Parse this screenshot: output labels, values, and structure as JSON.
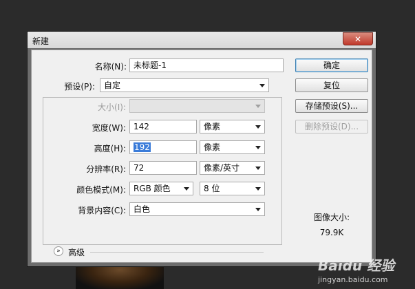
{
  "dialog": {
    "title": "新建",
    "close_label": "✕",
    "name_label": "名称(N):",
    "name_value": "未标题-1",
    "preset_label": "预设(P):",
    "preset_value": "自定",
    "size_label": "大小(I):",
    "size_value": "",
    "width_label": "宽度(W):",
    "width_value": "142",
    "width_unit": "像素",
    "height_label": "高度(H):",
    "height_value": "192",
    "height_unit": "像素",
    "resolution_label": "分辨率(R):",
    "resolution_value": "72",
    "resolution_unit": "像素/英寸",
    "color_mode_label": "颜色模式(M):",
    "color_mode_value": "RGB 颜色",
    "bit_depth_value": "8 位",
    "background_label": "背景内容(C):",
    "background_value": "白色",
    "advanced_label": "高级",
    "image_size_label": "图像大小:",
    "image_size_value": "79.9K"
  },
  "buttons": {
    "ok": "确定",
    "reset": "复位",
    "save_preset": "存储预设(S)...",
    "delete_preset": "删除预设(D)..."
  },
  "watermark": {
    "brand": "Baidu 经验",
    "url": "jingyan.baidu.com"
  },
  "colors": {
    "background": "#2b2b2b",
    "dialog_face": "#f0f0f0",
    "selection": "#3b7cd9",
    "close_button": "#c0392b"
  }
}
